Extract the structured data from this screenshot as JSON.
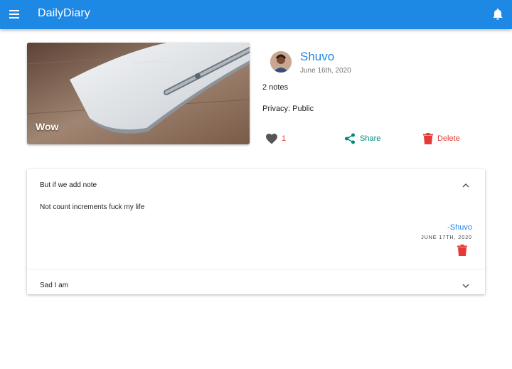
{
  "appbar": {
    "title": "DailyDiary",
    "color": "#1e88e5",
    "icons": {
      "menu": "menu-icon",
      "notifications": "bell-icon"
    }
  },
  "diary": {
    "cover_caption": "Wow",
    "author": "Shuvo",
    "date": "June 16th, 2020",
    "notes_count": "2 notes",
    "privacy": "Privacy: Public",
    "actions": {
      "likes": "1",
      "share": "Share",
      "delete": "Delete"
    }
  },
  "notes": [
    {
      "title": "But if we add note",
      "expanded": true,
      "body": "Not count increments fuck my life",
      "author": "-Shuvo",
      "date": "JUNE 17TH, 2020"
    },
    {
      "title": "Sad I am",
      "expanded": false
    }
  ],
  "colors": {
    "accent": "#1e88e5",
    "danger": "#e53935",
    "share": "#00897b"
  }
}
